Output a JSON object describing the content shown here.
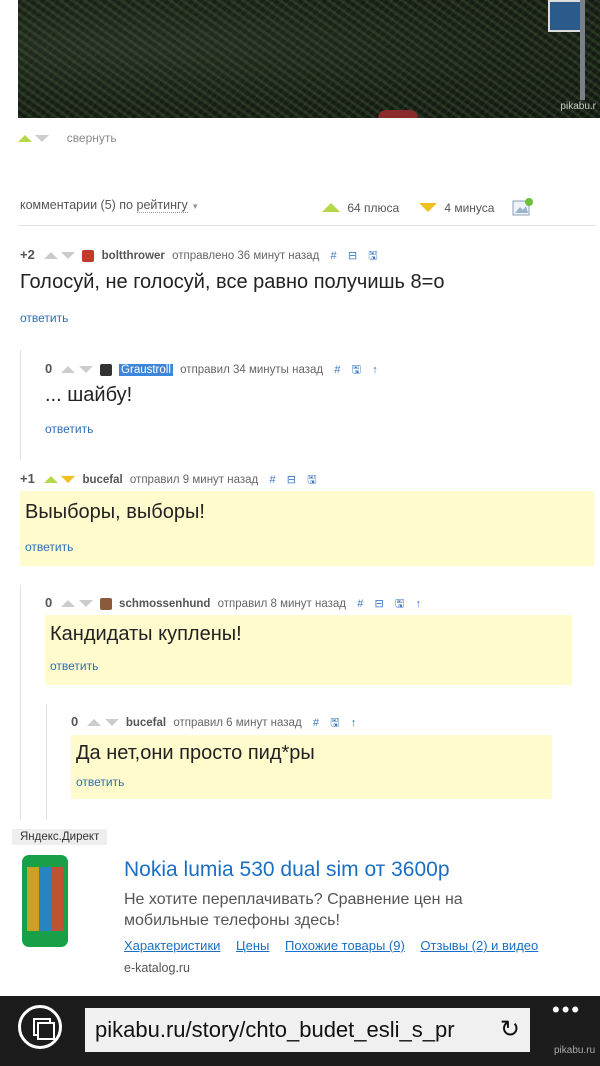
{
  "photo": {
    "watermark": "pikabu.r"
  },
  "collapse_label": "свернуть",
  "sortbar": {
    "prefix": "комментарии (5) по",
    "sort_by": "рейтингу",
    "plus": "64 плюса",
    "minus": "4 минуса"
  },
  "comments": [
    {
      "score": "+2",
      "user": "boltthrower",
      "action": "отправлено 36 минут назад",
      "text": "Голосуй, не голосуй, все равно получишь 8=о",
      "reply": "ответить"
    },
    {
      "score": "0",
      "user": "Graustroll",
      "action": "отправил 34 минуты назад",
      "text": "... шайбу!",
      "reply": "ответить"
    },
    {
      "score": "+1",
      "user": "bucefal",
      "action": "отправил 9 минут назад",
      "text": "Выыборы, выборы!",
      "reply": "ответить"
    },
    {
      "score": "0",
      "user": "schmossenhund",
      "action": "отправил 8 минут назад",
      "text": "Кандидаты куплены!",
      "reply": "ответить"
    },
    {
      "score": "0",
      "user": "bucefal",
      "action": "отправил 6 минут назад",
      "text": "Да нет,они просто пид*ры",
      "reply": "ответить"
    }
  ],
  "ad": {
    "label": "Яндекс.Директ",
    "title": "Nokia lumia 530 dual sim от 3600р",
    "description": "Не хотите переплачивать? Сравнение цен на мобильные телефоны здесь!",
    "links": [
      "Характеристики",
      "Цены",
      "Похожие товары (9)",
      "Отзывы (2) и видео"
    ],
    "domain": "e-katalog.ru"
  },
  "browser": {
    "url": "pikabu.ru/story/chto_budet_esli_s_pr",
    "more": "•••",
    "watermark": "pikabu.ru"
  },
  "icons": {
    "hash": "#",
    "collapse": "⊟",
    "save": "🖫",
    "parent": "↑"
  },
  "colors": {
    "accent_green": "#b5d84a",
    "highlight_yellow": "#fffbcd",
    "link_blue": "#2a6fb5"
  }
}
